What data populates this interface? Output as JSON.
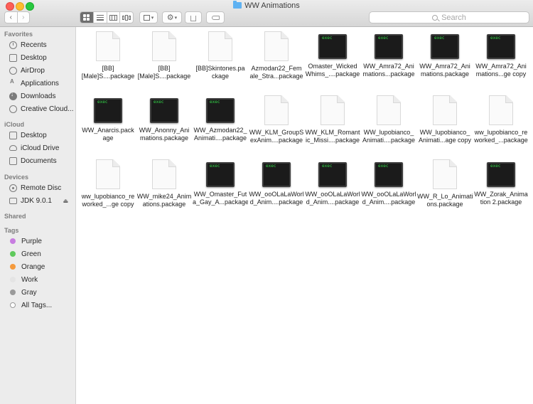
{
  "window": {
    "title": "WW Animations"
  },
  "toolbar": {
    "back_icon": "chevron-left-icon",
    "forward_icon": "chevron-right-icon",
    "search_placeholder": "Search"
  },
  "sidebar": {
    "favorites_header": "Favorites",
    "favorites": [
      {
        "label": "Recents",
        "icon": "clock-icon"
      },
      {
        "label": "Desktop",
        "icon": "desktop-icon"
      },
      {
        "label": "AirDrop",
        "icon": "airdrop-icon"
      },
      {
        "label": "Applications",
        "icon": "applications-icon"
      },
      {
        "label": "Downloads",
        "icon": "downloads-icon"
      },
      {
        "label": "Creative Cloud...",
        "icon": "creative-cloud-icon"
      }
    ],
    "icloud_header": "iCloud",
    "icloud": [
      {
        "label": "Desktop",
        "icon": "desktop-icon"
      },
      {
        "label": "iCloud Drive",
        "icon": "cloud-icon"
      },
      {
        "label": "Documents",
        "icon": "document-icon"
      }
    ],
    "devices_header": "Devices",
    "devices": [
      {
        "label": "Remote Disc",
        "icon": "disc-icon"
      },
      {
        "label": "JDK 9.0.1",
        "icon": "drive-icon"
      }
    ],
    "eject_glyph": "⏏",
    "shared_header": "Shared",
    "tags_header": "Tags",
    "tags": [
      {
        "label": "Purple",
        "color": "#c77de0"
      },
      {
        "label": "Green",
        "color": "#5fc95c"
      },
      {
        "label": "Orange",
        "color": "#f59a3c"
      },
      {
        "label": "Work",
        "color": "#e4e4e4"
      },
      {
        "label": "Gray",
        "color": "#9a9a9a"
      },
      {
        "label": "All Tags...",
        "color": "#ffffff"
      }
    ]
  },
  "files": [
    {
      "name": "[BB]\n[Male]S....package",
      "kind": "document"
    },
    {
      "name": "[BB]\n[Male]S....package",
      "kind": "document"
    },
    {
      "name": "[BB]Skintones.pa\nckage",
      "kind": "document"
    },
    {
      "name": "Azmodan22_Fem\nale_Stra...package",
      "kind": "document"
    },
    {
      "name": "Omaster_Wicked\nWhims_....package",
      "kind": "exec"
    },
    {
      "name": "WW_Amra72_Ani\nmations...package",
      "kind": "exec"
    },
    {
      "name": "WW_Amra72_Ani\nmations.package",
      "kind": "exec"
    },
    {
      "name": "WW_Amra72_Ani\nmations...ge copy",
      "kind": "exec"
    },
    {
      "name": "WW_Anarcis.pack\nage",
      "kind": "exec"
    },
    {
      "name": "WW_Anonny_Ani\nmations.package",
      "kind": "exec"
    },
    {
      "name": "WW_Azmodan22_\nAnimati....package",
      "kind": "exec"
    },
    {
      "name": "WW_KLM_GroupS\nexAnim....package",
      "kind": "document"
    },
    {
      "name": "WW_KLM_Romant\nic_Missi....package",
      "kind": "document"
    },
    {
      "name": "WW_lupobianco_\nAnimati....package",
      "kind": "document"
    },
    {
      "name": "WW_lupobianco_\nAnimati...age copy",
      "kind": "document"
    },
    {
      "name": "ww_lupobianco_re\nworked_...package",
      "kind": "document"
    },
    {
      "name": "ww_lupobianco_re\nworked_...ge copy",
      "kind": "document"
    },
    {
      "name": "WW_mike24_Anim\nations.package",
      "kind": "document"
    },
    {
      "name": "WW_Omaster_Fut\na_Gay_A...package",
      "kind": "exec"
    },
    {
      "name": "WW_ooOLaLaWorl\nd_Anim....package",
      "kind": "exec"
    },
    {
      "name": "WW_ooOLaLaWorl\nd_Anim....package",
      "kind": "exec"
    },
    {
      "name": "WW_ooOLaLaWorl\nd_Anim....package",
      "kind": "exec"
    },
    {
      "name": "WW_R_Lo_Animati\nons.package",
      "kind": "document"
    },
    {
      "name": "WW_Zorak_Anima\ntion 2.package",
      "kind": "exec"
    }
  ],
  "exec_label": "exec"
}
